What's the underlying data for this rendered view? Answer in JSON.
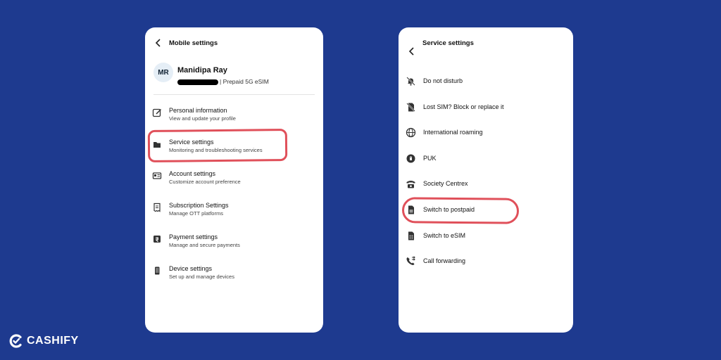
{
  "left_screen": {
    "header_title": "Mobile settings",
    "profile": {
      "initials": "MR",
      "name": "Manidipa Ray",
      "plan": "| Prepaid 5G eSIM"
    },
    "items": [
      {
        "title": "Personal information",
        "subtitle": "View and update your profile",
        "icon": "edit-icon"
      },
      {
        "title": "Service settings",
        "subtitle": "Monitoring and troubleshooting services",
        "icon": "sim-folder-icon"
      },
      {
        "title": "Account settings",
        "subtitle": "Customize account preference",
        "icon": "id-card-icon"
      },
      {
        "title": "Subscription Settings",
        "subtitle": "Manage OTT platforms",
        "icon": "receipt-icon"
      },
      {
        "title": "Payment settings",
        "subtitle": "Manage and secure payments",
        "icon": "rupee-icon"
      },
      {
        "title": "Device settings",
        "subtitle": "Set up and manage devices",
        "icon": "phone-icon"
      }
    ]
  },
  "right_screen": {
    "header_title": "Service settings",
    "items": [
      {
        "title": "Do not disturb",
        "icon": "bell-off-icon"
      },
      {
        "title": "Lost SIM? Block or replace it",
        "icon": "sim-off-icon"
      },
      {
        "title": "International roaming",
        "icon": "globe-icon"
      },
      {
        "title": "PUK",
        "icon": "lock-icon"
      },
      {
        "title": "Society Centrex",
        "icon": "telephone-icon"
      },
      {
        "title": "Switch to postpaid",
        "icon": "sim-icon"
      },
      {
        "title": "Switch to eSIM",
        "icon": "esim-icon"
      },
      {
        "title": "Call forwarding",
        "icon": "call-forward-icon"
      }
    ]
  },
  "brand": {
    "name": "CASHIFY"
  },
  "colors": {
    "background": "#1e3a8f",
    "highlight": "#e0505a"
  }
}
